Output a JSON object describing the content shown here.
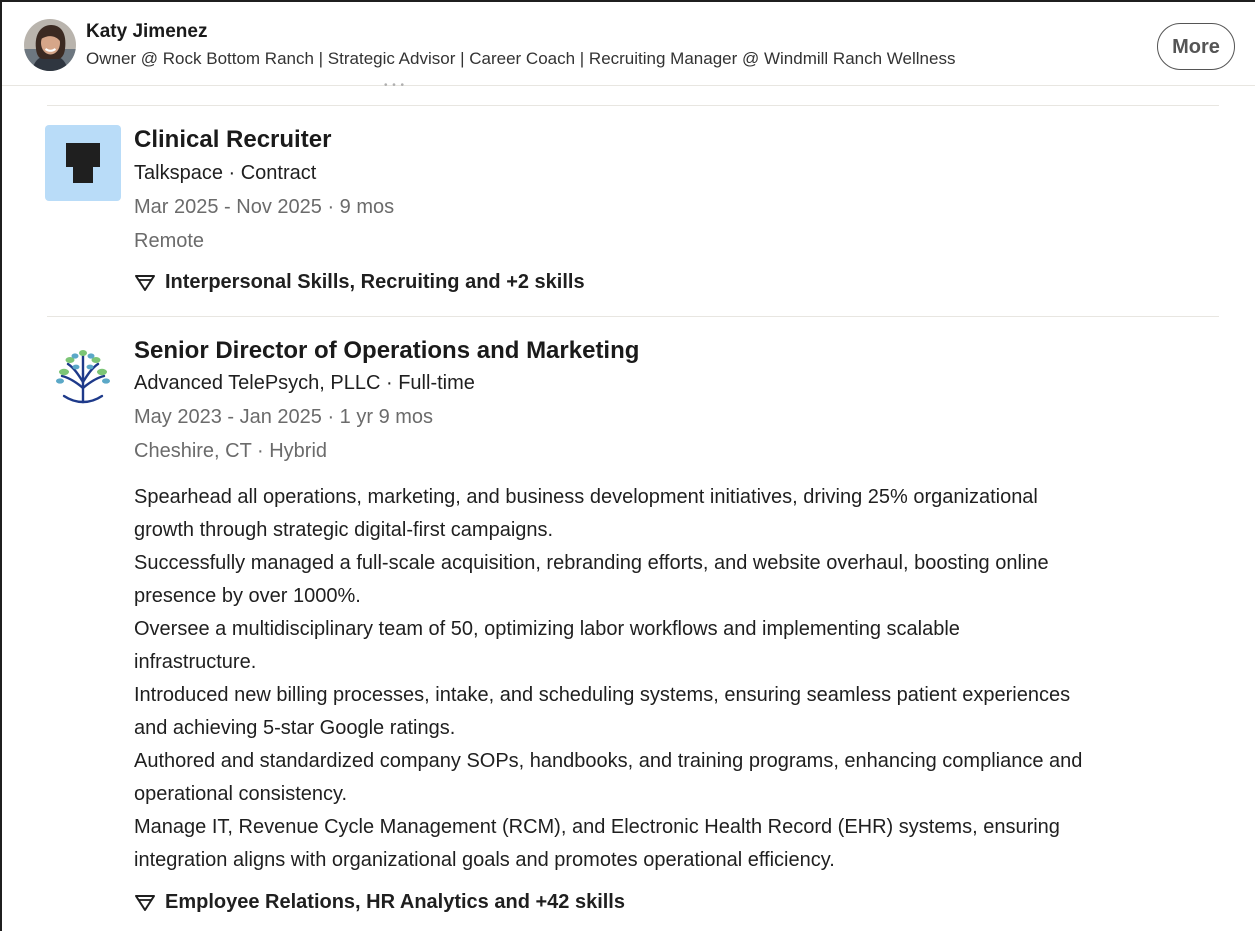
{
  "header": {
    "name": "Katy Jimenez",
    "headline": "Owner @ Rock Bottom Ranch | Strategic Advisor | Career Coach | Recruiting Manager @ Windmill Ranch Wellness",
    "more_label": "More",
    "scroll_hint": "• • •"
  },
  "experience": [
    {
      "logo": "talkspace-logo",
      "title": "Clinical Recruiter",
      "company": "Talkspace · Contract",
      "dates": "Mar 2025 - Nov 2025 · 9 mos",
      "location": "Remote",
      "skills": "Interpersonal Skills, Recruiting and +2 skills"
    },
    {
      "logo": "advanced-telepsych-tree-logo",
      "title": "Senior Director of Operations and Marketing",
      "company": "Advanced TelePsych, PLLC · Full-time",
      "dates": "May 2023 - Jan 2025 · 1 yr 9 mos",
      "location": "Cheshire, CT · Hybrid",
      "description": [
        "Spearhead all operations, marketing, and business development initiatives, driving 25% organizational",
        "growth through strategic digital-first campaigns.",
        "Successfully managed a full-scale acquisition, rebranding efforts, and website overhaul, boosting online",
        "presence by over 1000%.",
        "Oversee a multidisciplinary team of 50, optimizing labor workflows and implementing scalable",
        "infrastructure.",
        "Introduced new billing processes, intake, and scheduling systems, ensuring seamless patient experiences",
        "and achieving 5-star Google ratings.",
        "Authored and standardized company SOPs, handbooks, and training programs, enhancing compliance and",
        "operational consistency.",
        "Manage IT, Revenue Cycle Management (RCM), and Electronic Health Record (EHR) systems, ensuring",
        "integration aligns with organizational goals and promotes operational efficiency."
      ],
      "skills": "Employee Relations, HR Analytics and +42 skills"
    }
  ],
  "colors": {
    "talkspace_logo_bg": "#b9dcf8",
    "talkspace_logo_mark": "#1f1f1f",
    "tree_blue": "#1e3a8a",
    "tree_green": "#7cc576",
    "tree_teal": "#5ba8c7",
    "divider": "#e8e6e1",
    "muted_text": "#6b6b6b"
  }
}
